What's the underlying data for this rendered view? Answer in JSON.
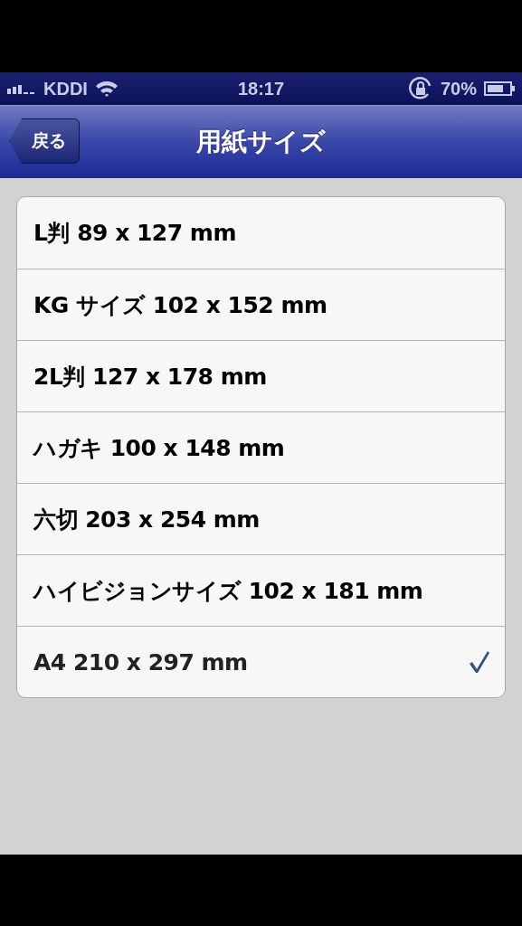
{
  "status_bar": {
    "carrier": "KDDI",
    "time": "18:17",
    "battery": "70%"
  },
  "nav_bar": {
    "back_button": "戻る",
    "title": "用紙サイズ"
  },
  "paper_sizes": [
    {
      "label": "L判 89 x 127 mm",
      "selected": false
    },
    {
      "label": "KG サイズ 102 x 152 mm",
      "selected": false
    },
    {
      "label": "2L判 127 x 178 mm",
      "selected": false
    },
    {
      "label": "ハガキ 100 x 148 mm",
      "selected": false
    },
    {
      "label": "六切 203 x 254 mm",
      "selected": false
    },
    {
      "label": "ハイビジョンサイズ 102 x 181 mm",
      "selected": false
    },
    {
      "label": "A4 210 x 297 mm",
      "selected": true
    }
  ]
}
